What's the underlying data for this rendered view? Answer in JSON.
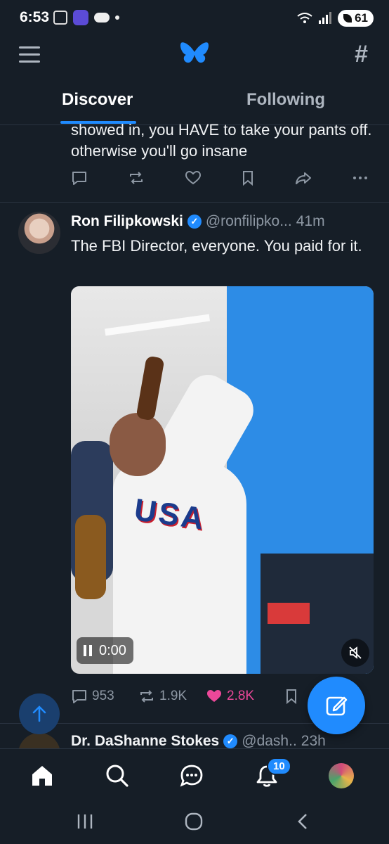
{
  "status_bar": {
    "time": "6:53",
    "battery": "61"
  },
  "tabs": [
    {
      "label": "Discover"
    },
    {
      "label": "Following"
    }
  ],
  "prev_post": {
    "text": "showed in, you HAVE to take your pants off. otherwise you'll go insane"
  },
  "post": {
    "author_name": "Ron Filipkowski",
    "handle": "@ronfilipko...",
    "age": "41m",
    "text": "The FBI Director, everyone. You paid for it.",
    "video_overlay_text": "USA",
    "video_time": "0:00",
    "replies": "953",
    "reposts": "1.9K",
    "likes": "2.8K"
  },
  "next_post": {
    "author_name": "Dr. DaShanne Stokes",
    "handle": "@dash..",
    "age": "23h"
  },
  "bottom_nav": {
    "notifications_count": "10"
  },
  "colors": {
    "accent": "#208bfe",
    "like": "#ec4899",
    "background": "#161e27"
  },
  "icons": [
    "menu-icon",
    "butterfly-logo-icon",
    "hash-icon",
    "reply-icon",
    "repost-icon",
    "like-icon",
    "bookmark-icon",
    "share-icon",
    "more-icon",
    "compose-icon",
    "arrow-up-icon",
    "home-icon",
    "search-icon",
    "chat-icon",
    "bell-icon"
  ]
}
